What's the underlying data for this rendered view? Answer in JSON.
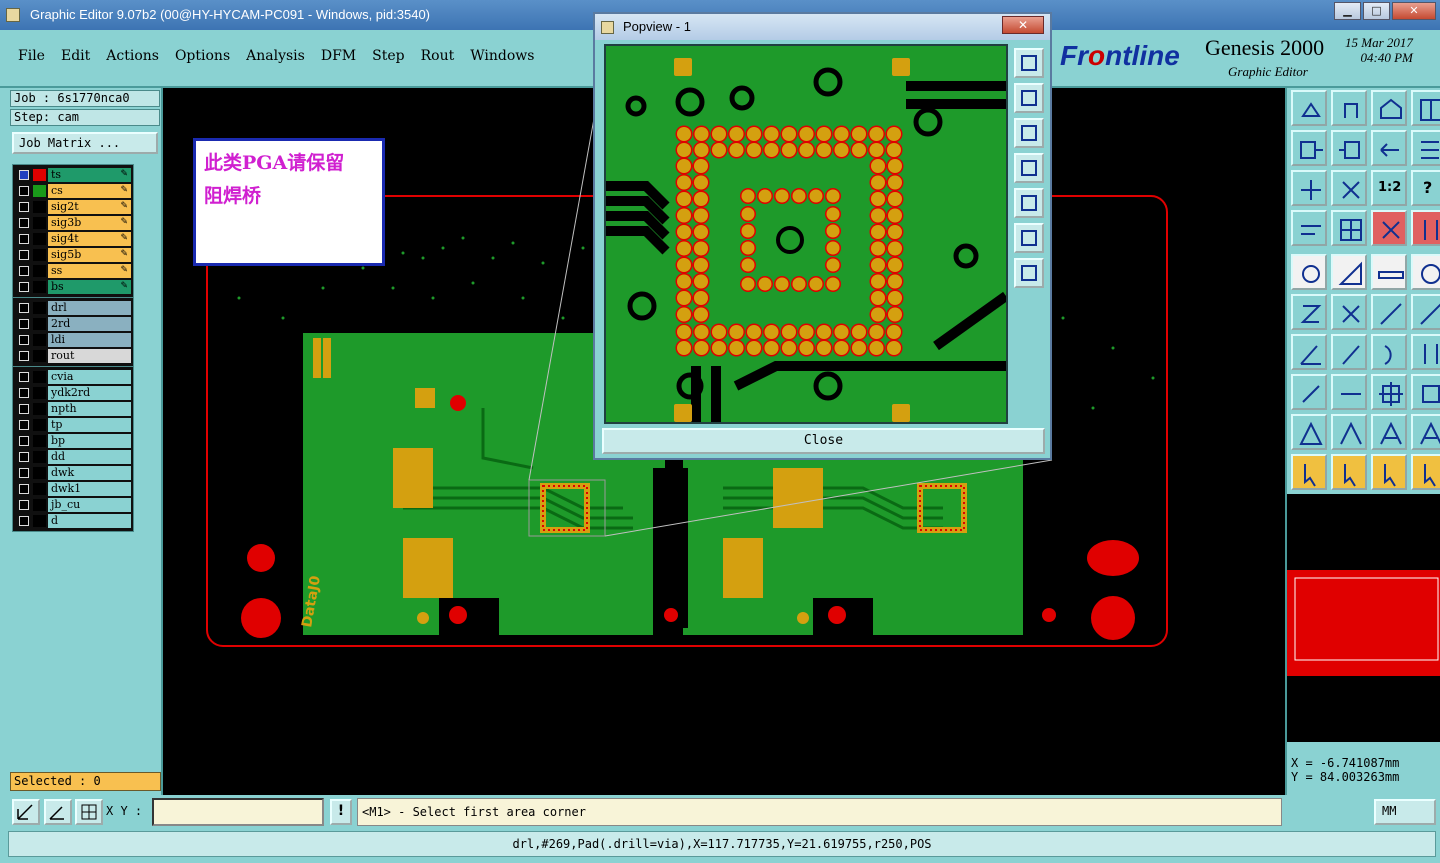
{
  "window": {
    "title": "Graphic Editor 9.07b2 (00@HY-HYCAM-PC091 - Windows, pid:3540)",
    "minimize": "▁",
    "maximize": "□",
    "close": "✕"
  },
  "menubar": {
    "items": [
      "File",
      "Edit",
      "Actions",
      "Options",
      "Analysis",
      "DFM",
      "Step",
      "Rout",
      "Windows"
    ]
  },
  "brand": {
    "logo_pre": "Fr",
    "logo_o": "o",
    "logo_post": "ntline",
    "product": "Genesis 2000",
    "subtitle": "Graphic Editor",
    "date": "15 Mar 2017",
    "time": "04:40 PM"
  },
  "left_panel": {
    "job": "Job : 6s1770nca0",
    "step": "Step: cam",
    "job_matrix": "Job Matrix ...",
    "selected": "Selected : 0",
    "board_layers": [
      {
        "name": "ts",
        "color": "#1f9a6a",
        "swatch": "#e00000",
        "checked": true
      },
      {
        "name": "cs",
        "color": "#f8c050",
        "swatch": "#1a9a1a",
        "checked": false
      },
      {
        "name": "sig2t",
        "color": "#f8c050",
        "swatch": "#000000",
        "checked": false
      },
      {
        "name": "sig3b",
        "color": "#f8c050",
        "swatch": "#000000",
        "checked": false
      },
      {
        "name": "sig4t",
        "color": "#f8c050",
        "swatch": "#000000",
        "checked": false
      },
      {
        "name": "sig5b",
        "color": "#f8c050",
        "swatch": "#000000",
        "checked": false
      },
      {
        "name": "ss",
        "color": "#f8c050",
        "swatch": "#000000",
        "checked": false
      },
      {
        "name": "bs",
        "color": "#1f9a6a",
        "swatch": "#000000",
        "checked": false
      }
    ],
    "drill_layers": [
      {
        "name": "drl",
        "color": "#8ab0c0"
      },
      {
        "name": "2rd",
        "color": "#8ab0c0"
      },
      {
        "name": "ldi",
        "color": "#8ab0c0"
      },
      {
        "name": "rout",
        "color": "#d8d8d8"
      }
    ],
    "misc_layers": [
      {
        "name": "cvia",
        "color": "#8ad2d2"
      },
      {
        "name": "ydk2rd",
        "color": "#8ad2d2"
      },
      {
        "name": "npth",
        "color": "#8ad2d2"
      },
      {
        "name": "tp",
        "color": "#8ad2d2"
      },
      {
        "name": "bp",
        "color": "#8ad2d2"
      },
      {
        "name": "dd",
        "color": "#8ad2d2"
      },
      {
        "name": "dwk",
        "color": "#8ad2d2"
      },
      {
        "name": "dwk1",
        "color": "#8ad2d2"
      },
      {
        "name": "jb_cu",
        "color": "#8ad2d2"
      },
      {
        "name": "d",
        "color": "#8ad2d2"
      }
    ]
  },
  "canvas": {
    "note_line1": "此类PGA请保留",
    "note_line2": "阻焊桥",
    "board_text": "DataJ0",
    "colors": {
      "board": "#1e9a2a",
      "pad": "#d4a010",
      "mask": "#e00000"
    }
  },
  "popview": {
    "title": "Popview - 1",
    "close_label": "Close"
  },
  "right_panel": {
    "ratio_label": "1:2",
    "coord_x": "X  = -6.741087mm",
    "coord_y": "Y  = 84.003263mm"
  },
  "bottom": {
    "xy_label": "X Y :",
    "xy_value": "",
    "excl": "!",
    "prompt": "<M1> - Select first area corner",
    "units": "MM",
    "status": "drl,#269,Pad(.drill=via),X=117.717735,Y=21.619755,r250,POS"
  }
}
